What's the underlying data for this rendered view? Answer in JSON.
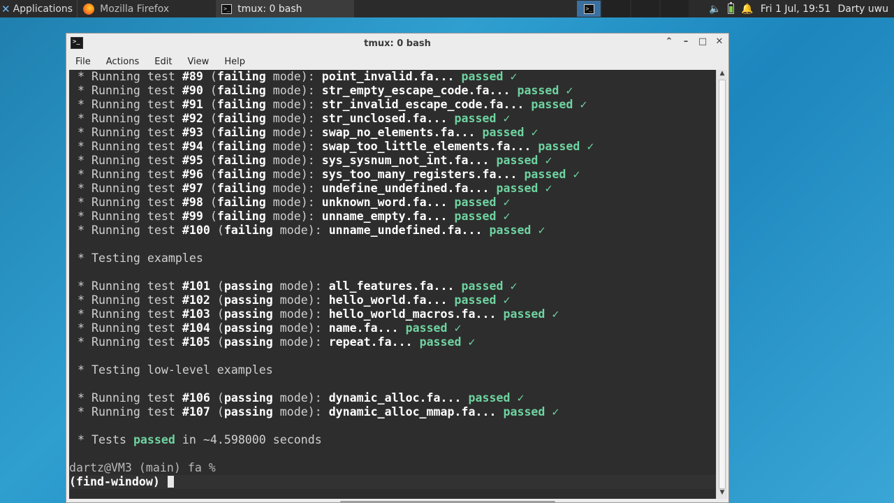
{
  "panel": {
    "applications_label": "Applications",
    "tasks": [
      {
        "label": "Mozilla Firefox"
      },
      {
        "label": "tmux: 0 bash"
      }
    ],
    "clock": "Fri  1 Jul, 19:51",
    "user": "Darty uwu"
  },
  "window": {
    "title": "tmux: 0 bash",
    "menu": [
      "File",
      "Actions",
      "Edit",
      "View",
      "Help"
    ]
  },
  "terminal": {
    "failing_tests": [
      {
        "num": "#89",
        "file": "point_invalid.fa..."
      },
      {
        "num": "#90",
        "file": "str_empty_escape_code.fa..."
      },
      {
        "num": "#91",
        "file": "str_invalid_escape_code.fa..."
      },
      {
        "num": "#92",
        "file": "str_unclosed.fa..."
      },
      {
        "num": "#93",
        "file": "swap_no_elements.fa..."
      },
      {
        "num": "#94",
        "file": "swap_too_little_elements.fa..."
      },
      {
        "num": "#95",
        "file": "sys_sysnum_not_int.fa..."
      },
      {
        "num": "#96",
        "file": "sys_too_many_registers.fa..."
      },
      {
        "num": "#97",
        "file": "undefine_undefined.fa..."
      },
      {
        "num": "#98",
        "file": "unknown_word.fa..."
      },
      {
        "num": "#99",
        "file": "unname_empty.fa..."
      },
      {
        "num": "#100",
        "file": "unname_undefined.fa..."
      }
    ],
    "section_examples": "Testing examples",
    "example_tests": [
      {
        "num": "#101",
        "file": "all_features.fa..."
      },
      {
        "num": "#102",
        "file": "hello_world.fa..."
      },
      {
        "num": "#103",
        "file": "hello_world_macros.fa..."
      },
      {
        "num": "#104",
        "file": "name.fa..."
      },
      {
        "num": "#105",
        "file": "repeat.fa..."
      }
    ],
    "section_lowlevel": "Testing low-level examples",
    "lowlevel_tests": [
      {
        "num": "#106",
        "file": "dynamic_alloc.fa..."
      },
      {
        "num": "#107",
        "file": "dynamic_alloc_mmap.fa..."
      }
    ],
    "summary_prefix": "Tests",
    "summary_passed": "passed",
    "summary_suffix": "in ~4.598000 seconds",
    "prompt": "dartz@VM3 (main) fa %",
    "status_line": "(find-window)",
    "words": {
      "running_test": "Running test",
      "failing": "failing",
      "passing": "passing",
      "mode": "mode):",
      "passed": "passed",
      "check": "✓",
      "bullet": "*"
    }
  },
  "colors": {
    "terminal_bg": "#2d2d2d",
    "passed_green": "#6fd3a0",
    "desktop_blue": "#2a95c8"
  }
}
